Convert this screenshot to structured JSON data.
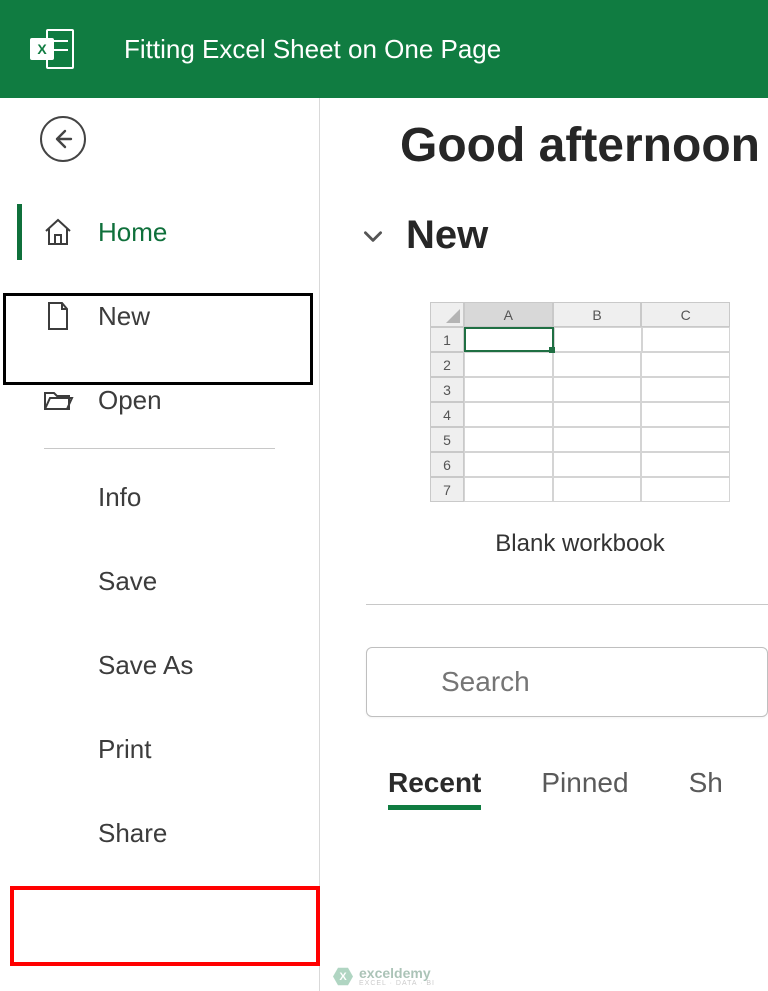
{
  "titlebar": {
    "title": "Fitting Excel Sheet on One Page"
  },
  "sidebar": {
    "items": [
      {
        "label": "Home"
      },
      {
        "label": "New"
      },
      {
        "label": "Open"
      },
      {
        "label": "Info"
      },
      {
        "label": "Save"
      },
      {
        "label": "Save As"
      },
      {
        "label": "Print"
      },
      {
        "label": "Share"
      }
    ]
  },
  "content": {
    "greeting": "Good afternoon",
    "new_section": "New",
    "template_label": "Blank workbook",
    "template_cols": [
      "A",
      "B",
      "C"
    ],
    "template_rows": [
      "1",
      "2",
      "3",
      "4",
      "5",
      "6",
      "7"
    ],
    "search_placeholder": "Search",
    "tabs": [
      {
        "label": "Recent",
        "selected": true
      },
      {
        "label": "Pinned",
        "selected": false
      },
      {
        "label": "Sh",
        "selected": false
      }
    ]
  },
  "watermark": {
    "brand": "exceldemy",
    "tagline": "EXCEL · DATA · BI"
  }
}
